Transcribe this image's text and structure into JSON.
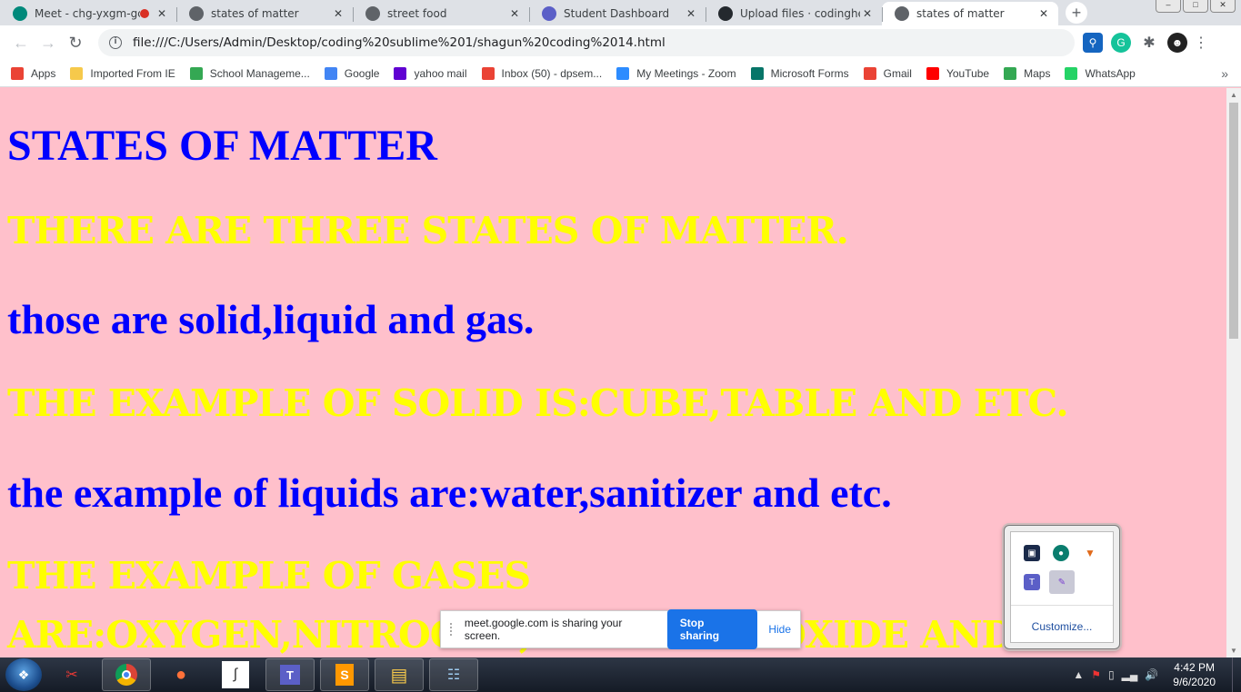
{
  "tabs": [
    {
      "title": "Meet - chg-yxgm-gc",
      "recording": true,
      "icon": "google-meet-icon",
      "color": "#00897b"
    },
    {
      "title": "states of matter",
      "icon": "globe-icon",
      "color": "#5f6368"
    },
    {
      "title": "street food",
      "icon": "globe-icon",
      "color": "#5f6368"
    },
    {
      "title": "Student Dashboard",
      "icon": "dashboard-icon",
      "color": "#5b5fc7"
    },
    {
      "title": "Upload files · codingherc",
      "icon": "github-icon",
      "color": "#24292e"
    },
    {
      "title": "states of matter",
      "icon": "globe-icon",
      "color": "#5f6368",
      "active": true
    }
  ],
  "toolbar": {
    "url": "file:///C:/Users/Admin/Desktop/coding%20sublime%201/shagun%20coding%2014.html"
  },
  "bookmarks": [
    {
      "label": "Apps",
      "icon": "apps-grid-icon",
      "color": "#ea4335"
    },
    {
      "label": "Imported From IE",
      "icon": "folder-icon",
      "color": "#f6c94b"
    },
    {
      "label": "School Manageme...",
      "icon": "school-icon",
      "color": "#34a853"
    },
    {
      "label": "Google",
      "icon": "google-icon",
      "color": "#4285f4"
    },
    {
      "label": "yahoo mail",
      "icon": "yahoo-icon",
      "color": "#6001d2"
    },
    {
      "label": "Inbox (50) - dpsem...",
      "icon": "gmail-icon",
      "color": "#ea4335"
    },
    {
      "label": "My Meetings - Zoom",
      "icon": "zoom-icon",
      "color": "#2d8cff"
    },
    {
      "label": "Microsoft Forms",
      "icon": "forms-icon",
      "color": "#077568"
    },
    {
      "label": "Gmail",
      "icon": "gmail-icon",
      "color": "#ea4335"
    },
    {
      "label": "YouTube",
      "icon": "youtube-icon",
      "color": "#ff0000"
    },
    {
      "label": "Maps",
      "icon": "maps-icon",
      "color": "#34a853"
    },
    {
      "label": "WhatsApp",
      "icon": "whatsapp-icon",
      "color": "#25d366"
    }
  ],
  "page": {
    "h1": "STATES OF MATTER",
    "line1": "there are three states of matter.",
    "line2": "those are solid,liquid and gas.",
    "line3": "the example of solid is:cube,table and etc.",
    "line4": "the example of liquids are:water,sanitizer and etc.",
    "line5a": "the example of gases",
    "line5b": "are:oxygen,nitrogen,carbon dioxide and etc."
  },
  "sharebar": {
    "message": "meet.google.com is sharing your screen.",
    "stop_label": "Stop sharing",
    "hide_label": "Hide"
  },
  "traypopup": {
    "customize_label": "Customize..."
  },
  "taskbar": {
    "time": "4:42 PM",
    "date": "9/6/2020"
  },
  "colors": {
    "page_bg": "#ffc0cb",
    "blue_text": "#0000ff",
    "yellow_text": "#ffff00",
    "accent": "#1a73e8"
  }
}
